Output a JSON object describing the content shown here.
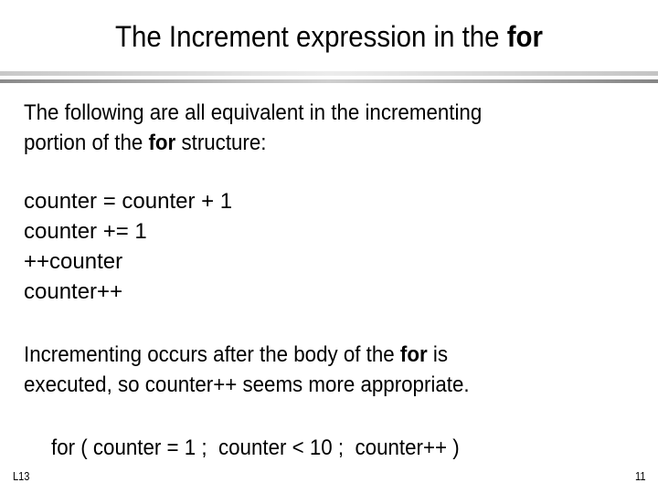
{
  "slide": {
    "title_prefix": "The Increment expression in the ",
    "title_keyword": "for",
    "intro": {
      "line1": "The following are all equivalent in the incrementing",
      "line2_prefix": "portion of the ",
      "line2_keyword": "for",
      "line2_suffix": " structure:"
    },
    "equivalents": [
      "counter = counter + 1",
      "counter += 1",
      "++counter",
      "counter++"
    ],
    "note": {
      "line1_prefix": "Incrementing occurs after the body of the ",
      "line1_keyword": "for",
      "line1_suffix": " is",
      "line2": "executed, so counter++ seems more appropriate."
    },
    "example": "for ( counter = 1 ;  counter < 10 ;  counter++ )",
    "footer": {
      "lecture": "L13",
      "page_number": "11"
    }
  }
}
